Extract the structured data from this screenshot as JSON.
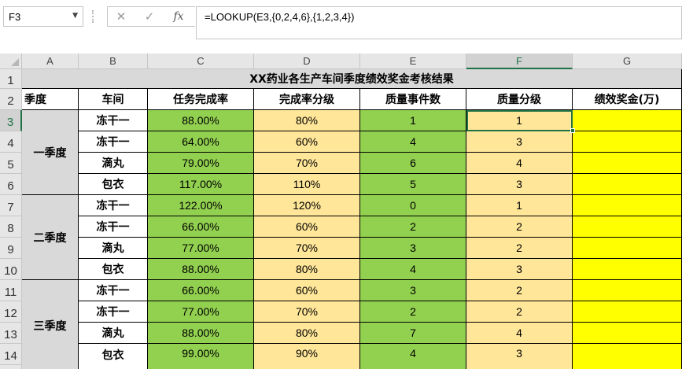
{
  "formula_bar": {
    "name_box": "F3",
    "cancel_icon": "✕",
    "enter_icon": "✓",
    "fx_label": "fx",
    "formula": "=LOOKUP(E3,{0,2,4,6},{1,2,3,4})"
  },
  "columns": [
    "A",
    "B",
    "C",
    "D",
    "E",
    "F",
    "G"
  ],
  "rows": [
    "1",
    "2",
    "3",
    "4",
    "5",
    "6",
    "7",
    "8",
    "9",
    "10",
    "11",
    "12",
    "13",
    "14"
  ],
  "title": "XX药业各生产车间季度绩效奖金考核结果",
  "headers": [
    "季度",
    "车间",
    "任务完成率",
    "完成率分级",
    "质量事件数",
    "质量分级",
    "绩效奖金(万)"
  ],
  "quarters": [
    "一季度",
    "二季度",
    "三季度"
  ],
  "table": [
    {
      "workshop": "冻干一",
      "rate": "88.00%",
      "rate_grade": "80%",
      "events": "1",
      "q_grade": "1",
      "bonus": ""
    },
    {
      "workshop": "冻干一",
      "rate": "64.00%",
      "rate_grade": "60%",
      "events": "4",
      "q_grade": "3",
      "bonus": ""
    },
    {
      "workshop": "滴丸",
      "rate": "79.00%",
      "rate_grade": "70%",
      "events": "6",
      "q_grade": "4",
      "bonus": ""
    },
    {
      "workshop": "包衣",
      "rate": "117.00%",
      "rate_grade": "110%",
      "events": "5",
      "q_grade": "3",
      "bonus": ""
    },
    {
      "workshop": "冻干一",
      "rate": "122.00%",
      "rate_grade": "120%",
      "events": "0",
      "q_grade": "1",
      "bonus": ""
    },
    {
      "workshop": "冻干一",
      "rate": "66.00%",
      "rate_grade": "60%",
      "events": "2",
      "q_grade": "2",
      "bonus": ""
    },
    {
      "workshop": "滴丸",
      "rate": "77.00%",
      "rate_grade": "70%",
      "events": "3",
      "q_grade": "2",
      "bonus": ""
    },
    {
      "workshop": "包衣",
      "rate": "88.00%",
      "rate_grade": "80%",
      "events": "4",
      "q_grade": "3",
      "bonus": ""
    },
    {
      "workshop": "冻干一",
      "rate": "66.00%",
      "rate_grade": "60%",
      "events": "3",
      "q_grade": "2",
      "bonus": ""
    },
    {
      "workshop": "冻干一",
      "rate": "77.00%",
      "rate_grade": "70%",
      "events": "2",
      "q_grade": "2",
      "bonus": ""
    },
    {
      "workshop": "滴丸",
      "rate": "88.00%",
      "rate_grade": "80%",
      "events": "7",
      "q_grade": "4",
      "bonus": ""
    },
    {
      "workshop": "包衣",
      "rate": "99.00%",
      "rate_grade": "90%",
      "events": "4",
      "q_grade": "3",
      "bonus": ""
    }
  ],
  "colors": {
    "green": "#92d050",
    "tan": "#ffe699",
    "yellow": "#ffff00",
    "gray": "#d9d9d9",
    "selection": "#217346"
  }
}
